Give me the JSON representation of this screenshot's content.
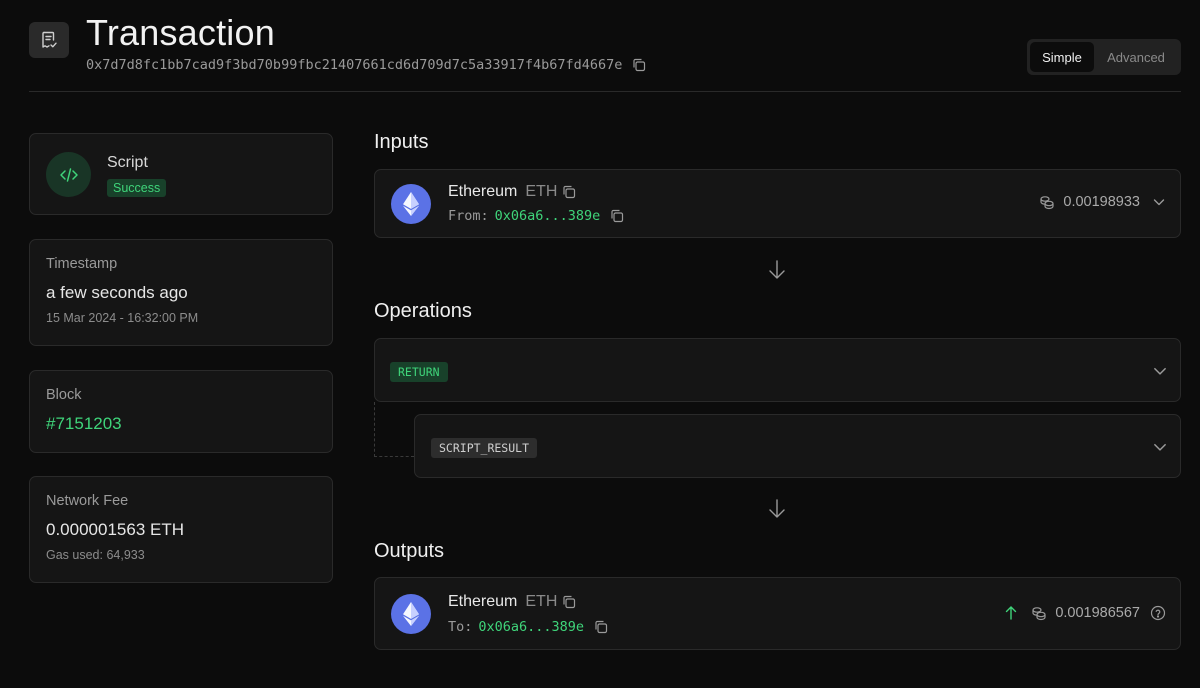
{
  "header": {
    "title": "Transaction",
    "tx_hash": "0x7d7d8fc1bb7cad9f3bd70b99fbc21407661cd6d709d7c5a33917f4b67fd4667e"
  },
  "view_toggle": {
    "simple_label": "Simple",
    "advanced_label": "Advanced",
    "selected": "Simple"
  },
  "summary": {
    "type_label": "Script",
    "status": "Success"
  },
  "timestamp": {
    "label": "Timestamp",
    "relative": "a few seconds ago",
    "absolute": "15 Mar 2024 - 16:32:00 PM"
  },
  "block": {
    "label": "Block",
    "value": "#7151203"
  },
  "network_fee": {
    "label": "Network Fee",
    "value": "0.000001563 ETH",
    "gas_used": "Gas used: 64,933"
  },
  "inputs": {
    "title": "Inputs",
    "asset_name": "Ethereum",
    "asset_symbol": "ETH",
    "from_label": "From:",
    "from_address": "0x06a6...389e",
    "amount": "0.00198933"
  },
  "operations": {
    "title": "Operations",
    "items": [
      {
        "label": "RETURN"
      },
      {
        "label": "SCRIPT_RESULT"
      }
    ]
  },
  "outputs": {
    "title": "Outputs",
    "asset_name": "Ethereum",
    "asset_symbol": "ETH",
    "to_label": "To:",
    "to_address": "0x06a6...389e",
    "amount": "0.001986567"
  },
  "colors": {
    "accent_green": "#3fd47a",
    "eth_blue": "#5b72e6",
    "background": "#0c0c0c"
  },
  "icons": [
    "receipt-check-icon",
    "copy-icon",
    "code-icon",
    "ethereum-icon",
    "coins-icon",
    "chevron-down-icon",
    "arrow-down-icon",
    "arrow-up-icon",
    "help-circle-icon"
  ]
}
